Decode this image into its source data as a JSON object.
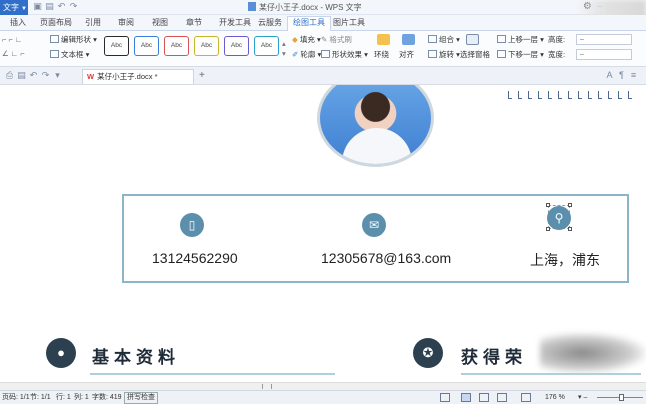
{
  "window": {
    "app_menu_label": "文字",
    "title": "某仔小王子.docx - WPS 文字"
  },
  "menu_tabs": [
    "插入",
    "页面布局",
    "引用",
    "审阅",
    "视图",
    "章节",
    "开发工具",
    "云服务",
    "绘图工具",
    "图片工具"
  ],
  "active_tab": "绘图工具",
  "ribbon": {
    "edit_shape": "编辑形状",
    "text_box": "文本框",
    "style_labels": [
      "Abc",
      "Abc",
      "Abc",
      "Abc",
      "Abc",
      "Abc"
    ],
    "style_colors": [
      "#2a2a2a",
      "#3b7dd8",
      "#d9534f",
      "#c9b52b",
      "#6a5acd",
      "#2ba0c9"
    ],
    "fill": "填充",
    "format_brush": "格式刷",
    "outline": "轮廓",
    "shape_effect": "形状效果",
    "wrap": "环绕",
    "align": "对齐",
    "group": "组合",
    "rotate": "旋转",
    "selection_pane": "选择窗格",
    "bring_forward": "上移一层",
    "send_backward": "下移一层",
    "height_label": "高度:",
    "width_label": "宽度:"
  },
  "doc_tab": {
    "logo": "W",
    "name": "某仔小王子.docx *"
  },
  "contact": {
    "phone": "13124562290",
    "email": "12305678@163.com",
    "location": "上海，浦东"
  },
  "sections": {
    "basic": "基本资料",
    "awards": "获得荣"
  },
  "status": {
    "page": "页码: 1/1",
    "section": "节: 1/1",
    "row": "行: 1",
    "col": "列: 1",
    "words": "字数: 419",
    "spell": "拼写检查",
    "zoom": "176 %"
  }
}
